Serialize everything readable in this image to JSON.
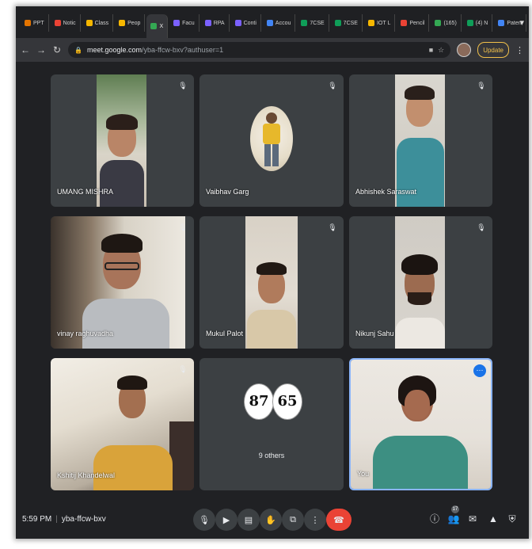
{
  "browser": {
    "tabs": [
      {
        "label": "PPT",
        "color": "#e37400"
      },
      {
        "label": "Notic",
        "color": "#ea4335"
      },
      {
        "label": "Class",
        "color": "#f6b700"
      },
      {
        "label": "Peop",
        "color": "#f6b700"
      },
      {
        "label": "X",
        "color": "#34a853",
        "active": true
      },
      {
        "label": "Facu",
        "color": "#7b61ff"
      },
      {
        "label": "RPA",
        "color": "#7b61ff"
      },
      {
        "label": "Conti",
        "color": "#7b61ff"
      },
      {
        "label": "Accou",
        "color": "#4285f4"
      },
      {
        "label": "7CSE",
        "color": "#0f9d58"
      },
      {
        "label": "7CSE",
        "color": "#0f9d58"
      },
      {
        "label": "IOT L",
        "color": "#f6b700"
      },
      {
        "label": "Pencil",
        "color": "#ea4335"
      },
      {
        "label": "(165)",
        "color": "#34a853"
      },
      {
        "label": "(4) N",
        "color": "#0f9d58"
      },
      {
        "label": "Paten",
        "color": "#4285f4"
      }
    ],
    "new_tab_symbol": "+",
    "url_host": "meet.google.com",
    "url_path": "/yba-ffcw-bxv?authuser=1",
    "update_label": "Update"
  },
  "participants": [
    {
      "name": "UMANG MISHRA"
    },
    {
      "name": "Vaibhav Garg"
    },
    {
      "name": "Abhishek Saraswat"
    },
    {
      "name": "vinay raghuvadha"
    },
    {
      "name": "Mukul Palot"
    },
    {
      "name": "Nikunj Sahu"
    },
    {
      "name": "Kshitij Khandelwal"
    },
    {
      "name": "You"
    }
  ],
  "others": {
    "label": "9 others",
    "avatar_a": "87",
    "avatar_b": "65"
  },
  "meeting": {
    "time": "5:59 PM",
    "code": "yba-ffcw-bxv"
  },
  "people_badge": "17",
  "colors": {
    "background": "#202124",
    "tile": "#3c4043",
    "end_call": "#ea4335",
    "self_border": "#8ab4f8"
  }
}
